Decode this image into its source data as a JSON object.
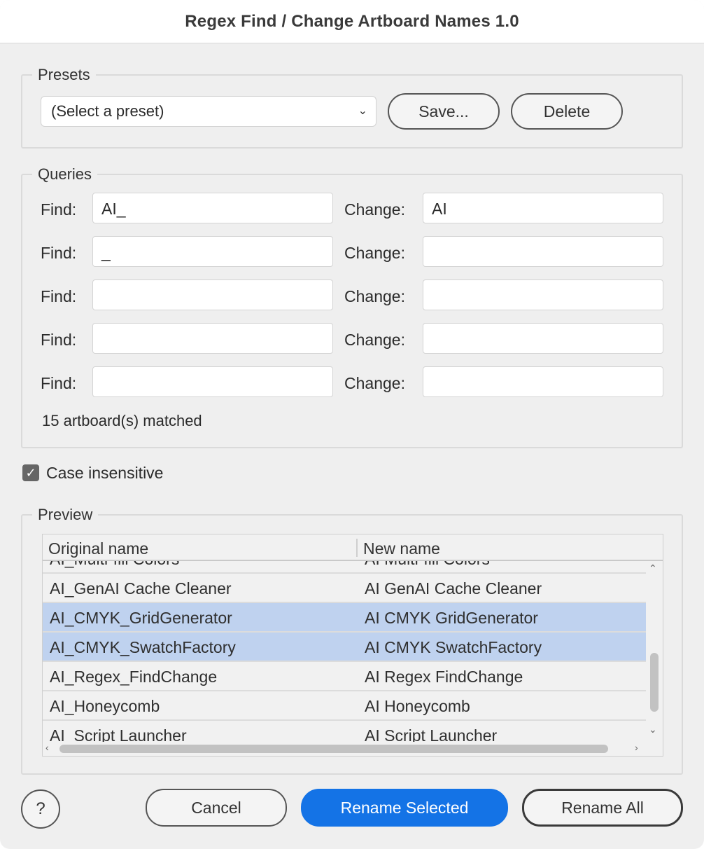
{
  "window": {
    "title": "Regex Find / Change Artboard Names 1.0"
  },
  "presets": {
    "group_label": "Presets",
    "select_value": "(Select a preset)",
    "save_label": "Save...",
    "delete_label": "Delete"
  },
  "queries": {
    "group_label": "Queries",
    "find_label": "Find:",
    "change_label": "Change:",
    "rows": [
      {
        "find": "AI_",
        "change": "AI"
      },
      {
        "find": "_",
        "change": ""
      },
      {
        "find": "",
        "change": ""
      },
      {
        "find": "",
        "change": ""
      },
      {
        "find": "",
        "change": ""
      }
    ],
    "match_count": "15 artboard(s) matched"
  },
  "options": {
    "case_insensitive_label": "Case insensitive",
    "case_insensitive_checked": true
  },
  "preview": {
    "group_label": "Preview",
    "col_original": "Original name",
    "col_new": "New name",
    "rows": [
      {
        "original": "AI_Multi-fill Colors",
        "new": "AI Multi-fill Colors",
        "selected": false
      },
      {
        "original": "AI_GenAI Cache Cleaner",
        "new": "AI GenAI Cache Cleaner",
        "selected": false
      },
      {
        "original": "AI_CMYK_GridGenerator",
        "new": "AI CMYK GridGenerator",
        "selected": true
      },
      {
        "original": "AI_CMYK_SwatchFactory",
        "new": "AI CMYK SwatchFactory",
        "selected": true
      },
      {
        "original": "AI_Regex_FindChange",
        "new": "AI Regex FindChange",
        "selected": false
      },
      {
        "original": "AI_Honeycomb",
        "new": "AI Honeycomb",
        "selected": false
      },
      {
        "original": "AI_Script Launcher",
        "new": "AI Script Launcher",
        "selected": false
      }
    ]
  },
  "footer": {
    "help_label": "?",
    "cancel_label": "Cancel",
    "rename_selected_label": "Rename Selected",
    "rename_all_label": "Rename All"
  },
  "colors": {
    "accent": "#1473e6",
    "selection": "#bfd2ef",
    "background": "#efefef"
  }
}
